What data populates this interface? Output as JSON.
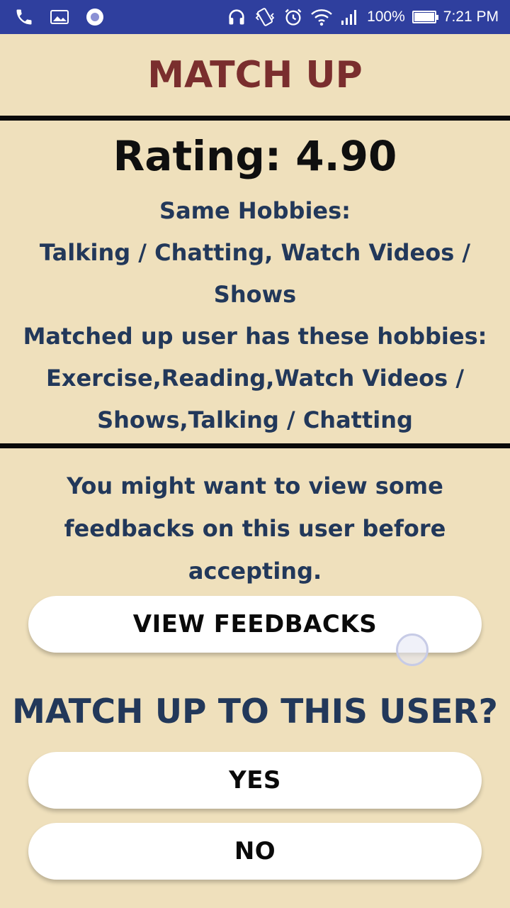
{
  "status_bar": {
    "battery": "100%",
    "time": "7:21 PM",
    "icons": [
      "phone-icon",
      "gallery-icon",
      "record-icon",
      "headphones-icon",
      "vibrate-icon",
      "alarm-icon",
      "wifi-icon",
      "signal-icon",
      "battery-icon"
    ]
  },
  "header": {
    "title": "MATCH UP"
  },
  "match": {
    "rating": "Rating: 4.90",
    "same_hobbies_label": "Same Hobbies:",
    "same_hobbies_line1": "Talking / Chatting, Watch Videos /",
    "same_hobbies_line2": "Shows",
    "user_hobbies_label": "Matched up user has these hobbies:",
    "user_hobbies_line1": "Exercise,Reading,Watch Videos /",
    "user_hobbies_line2": "Shows,Talking / Chatting"
  },
  "hint": {
    "line1": "You might want to view some",
    "line2": "feedbacks on this user before",
    "line3": "accepting."
  },
  "buttons": {
    "view_feedbacks": "VIEW FEEDBACKS",
    "yes": "YES",
    "no": "NO"
  },
  "question": "MATCH UP TO THIS USER?",
  "colors": {
    "background": "#efe0bc",
    "status_bar": "#2f3f9e",
    "title": "#7a2e2e",
    "text": "#22385a"
  }
}
